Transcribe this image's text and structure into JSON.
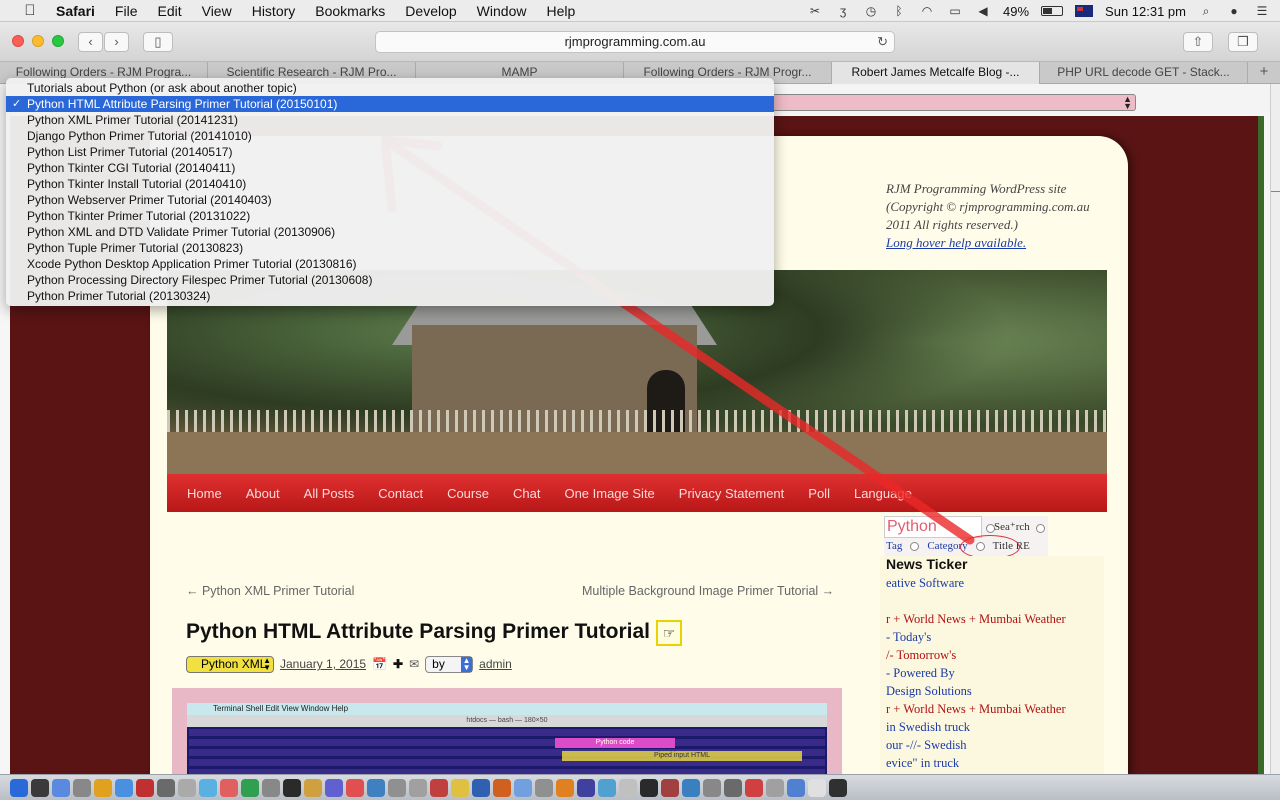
{
  "menubar": {
    "app_name": "Safari",
    "items": [
      "File",
      "Edit",
      "View",
      "History",
      "Bookmarks",
      "Develop",
      "Window",
      "Help"
    ],
    "battery": "49%",
    "battery_level": 0.49,
    "clock": "Sun 12:31 pm"
  },
  "toolbar": {
    "url": "rjmprogramming.com.au"
  },
  "tabs": [
    {
      "label": "Following Orders - RJM Progra..."
    },
    {
      "label": "Scientific Research - RJM Pro..."
    },
    {
      "label": "MAMP"
    },
    {
      "label": "Following Orders - RJM Progr..."
    },
    {
      "label": "Robert James Metcalfe Blog -..."
    },
    {
      "label": "PHP URL decode GET - Stack..."
    }
  ],
  "dropdown": {
    "options": [
      {
        "label": "Tutorials about Python (or ask about another topic)",
        "selected": false
      },
      {
        "label": "Python HTML Attribute Parsing Primer Tutorial (20150101)",
        "selected": true
      },
      {
        "label": "Python XML Primer Tutorial (20141231)",
        "selected": false
      },
      {
        "label": "Django Python Primer Tutorial (20141010)",
        "selected": false
      },
      {
        "label": "Python List Primer Tutorial (20140517)",
        "selected": false
      },
      {
        "label": "Python Tkinter CGI Tutorial (20140411)",
        "selected": false
      },
      {
        "label": "Python Tkinter Install Tutorial (20140410)",
        "selected": false
      },
      {
        "label": "Python Webserver Primer Tutorial (20140403)",
        "selected": false
      },
      {
        "label": "Python Tkinter Primer Tutorial (20131022)",
        "selected": false
      },
      {
        "label": "Python XML and DTD Validate Primer Tutorial (20130906)",
        "selected": false
      },
      {
        "label": "Python Tuple Primer Tutorial (20130823)",
        "selected": false
      },
      {
        "label": "Xcode Python Desktop Application Primer Tutorial (20130816)",
        "selected": false
      },
      {
        "label": "Python Processing Directory Filespec Primer Tutorial (20130608)",
        "selected": false
      },
      {
        "label": "Python Primer Tutorial (20130324)",
        "selected": false
      }
    ]
  },
  "site": {
    "description_line1": "RJM Programming WordPress site",
    "description_line2": "(Copyright © rjmprogramming.com.au",
    "description_line3": "2011 All rights reserved.)",
    "help_link": "Long hover help available."
  },
  "nav": {
    "items": [
      "Home",
      "About",
      "All Posts",
      "Contact",
      "Course",
      "Chat",
      "One Image Site",
      "Privacy Statement",
      "Poll",
      "Language"
    ]
  },
  "post": {
    "prev_link": "← Python XML Primer Tutorial",
    "next_link": "Multiple Background Image Primer Tutorial →",
    "title": "Python HTML Attribute Parsing Primer Tutorial",
    "tag_select": "Python XML",
    "date": "January 1, 2015",
    "by_select": "by",
    "author": "admin"
  },
  "screenshot_inset": {
    "terminal_menu": "Terminal   Shell   Edit   View   Window   Help",
    "window_title": "htdocs — bash — 180×50",
    "highlight1": "Python code",
    "highlight2": "Piped input HTML"
  },
  "search": {
    "value": "Python",
    "search_label": "Sea⁺rch",
    "filters": [
      "Tag",
      "Category",
      "Title RE"
    ]
  },
  "news": {
    "title": "News Ticker",
    "lines": [
      {
        "text": "eative Software",
        "color": "blue"
      },
      {
        "text": "",
        "color": "blue"
      },
      {
        "text": "r + World News + Mumbai Weather",
        "color": "red"
      },
      {
        "text": "- Today's",
        "color": "blue"
      },
      {
        "text": "/- Tomorrow's",
        "color": "red"
      },
      {
        "text": "- Powered By",
        "color": "blue"
      },
      {
        "text": "Design Solutions",
        "color": "blue"
      },
      {
        "text": "r + World News + Mumbai Weather",
        "color": "red"
      },
      {
        "text": "in Swedish truck",
        "color": "blue"
      },
      {
        "text": "our -//- Swedish",
        "color": "blue"
      },
      {
        "text": "evice\" in truck",
        "color": "blue"
      }
    ]
  },
  "colors": {
    "accent_red": "#d42020",
    "selection_blue": "#2a67d8",
    "maroon_bg": "#5a1414"
  }
}
